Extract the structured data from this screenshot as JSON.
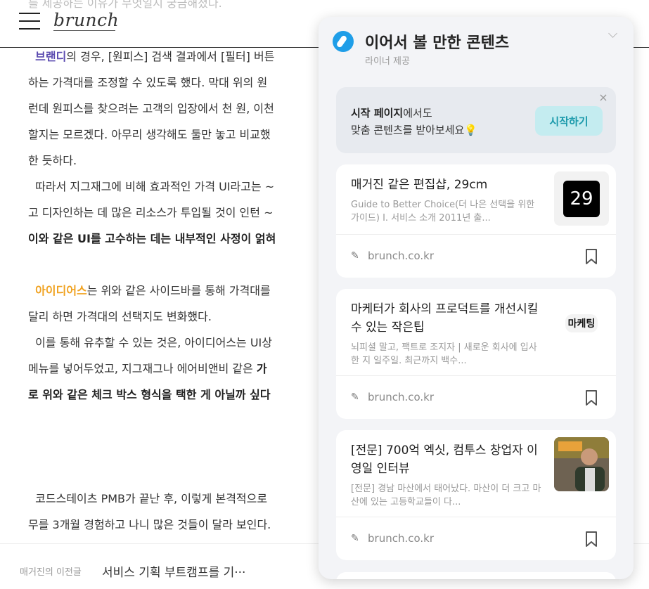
{
  "header": {
    "cut_text": "를 제공하는 이유가 무엇일지 궁금해졌다.",
    "logo": "brunch"
  },
  "article": {
    "lines": [
      {
        "pre": "",
        "hl": "브랜디",
        "post": "의 경우, [원피스] 검색 결과에서 [필터] 버튼"
      },
      {
        "text": "하는 가격대를 조정할 수 있도록 했다. 막대 위의 원"
      },
      {
        "text": "런데 원피스를 찾으려는 고객의 입장에서 천 원, 이천"
      },
      {
        "text": "할지는 모르겠다. 아무리 생각해도 둘만 놓고 비교했"
      },
      {
        "text": "한 듯하다."
      },
      {
        "text": "따라서 지그재그에 비해 효과적인 가격 UI라고는 ~"
      },
      {
        "text": "고 디자인하는 데 많은 리소스가 투입될 것이 인턴 ~"
      },
      {
        "bold": "이와 같은 UI를 고수하는 데는 내부적인 사정이 얽혀"
      },
      {
        "hl2": "아이디어스",
        "post": "는 위와 같은 사이드바를 통해 가격대를"
      },
      {
        "text": "달리 하면 가격대의 선택지도 변화했다."
      },
      {
        "text": "이를 통해 유추할 수 있는 것은, 아이디어스는 UI상"
      },
      {
        "text": "메뉴를 넣어두었고, 지그재그나 에어비앤비 같은 ",
        "bold": "가"
      },
      {
        "bold": "로 위와 같은 체크 박스 형식을 택한 게 아닐까 싶다"
      },
      {
        "text": "코드스테이츠 PMB가 끝난 후, 이렇게 본격적으로"
      },
      {
        "text": "무를 3개월 경험하고 나니 많은 것들이 달라 보인다."
      }
    ]
  },
  "bottom": {
    "label": "매거진의 이전글",
    "title": "서비스 기획 부트캠프를 기···"
  },
  "panel": {
    "title": "이어서 볼 만한 콘텐츠",
    "subtitle": "라이너 제공",
    "promo": {
      "line1_bold": "시작 페이지",
      "line1_rest": "에서도",
      "line2": "맞춤 콘텐츠를 받아보세요💡",
      "button": "시작하기",
      "close": "×"
    },
    "cards": [
      {
        "title": "매거진 같은 편집샵, 29cm",
        "desc": "Guide to Better Choice(더 나은 선택을 위한 가이드) I. 서비스 소개 2011년 출...",
        "thumb": "29",
        "source": "brunch.co.kr"
      },
      {
        "title": "마케터가 회사의 프로덕트를 개선시킬 수 있는 작은팁",
        "desc": "뇌피셜 말고, 팩트로 조지자 | 새로운 회사에 입사한 지 일주일. 최근까지 백수...",
        "thumb": "마케팅",
        "source": "brunch.co.kr"
      },
      {
        "title": "[전문] 700억 엑싯, 컴투스 창업자 이영일 인터뷰",
        "desc": "[전문] 경남 마산에서 태어났다. 마산이 더 크고 마산에 있는 고등학교들이 다...",
        "thumb": "",
        "source": "brunch.co.kr"
      }
    ]
  }
}
